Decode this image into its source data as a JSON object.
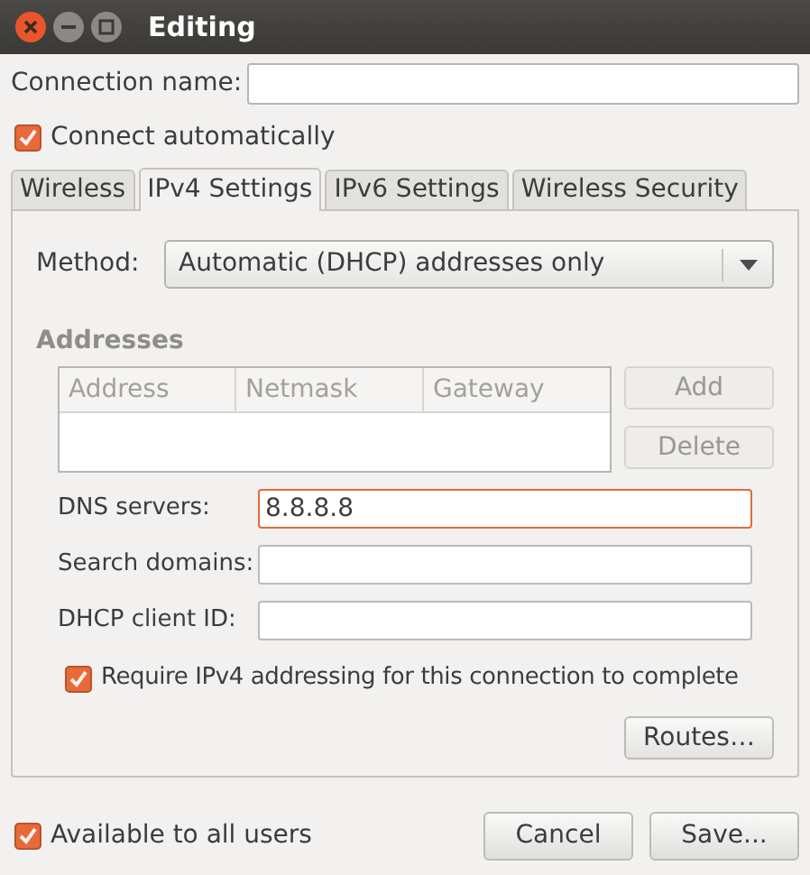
{
  "window": {
    "title": "Editing"
  },
  "connection_name": {
    "label": "Connection name:"
  },
  "connect_automatically": {
    "label": "Connect automatically",
    "checked": true
  },
  "tabs": [
    {
      "label": "Wireless",
      "selected": false
    },
    {
      "label": "IPv4 Settings",
      "selected": true
    },
    {
      "label": "IPv6 Settings",
      "selected": false
    },
    {
      "label": "Wireless Security",
      "selected": false
    }
  ],
  "method": {
    "label": "Method:",
    "value": "Automatic (DHCP) addresses only"
  },
  "addresses": {
    "heading": "Addresses",
    "disabled": true,
    "columns": [
      "Address",
      "Netmask",
      "Gateway"
    ],
    "buttons": [
      {
        "label": "Add",
        "disabled": true
      },
      {
        "label": "Delete",
        "disabled": true
      }
    ]
  },
  "fields": [
    {
      "label": "DNS servers:",
      "value": "8.8.8.8",
      "focused": true
    },
    {
      "label": "Search domains:",
      "focused": false
    },
    {
      "label": "DHCP client ID:",
      "focused": false
    }
  ],
  "require_ipv4": {
    "label": "Require IPv4 addressing for this connection to complete",
    "checked": true
  },
  "routes_button": {
    "label": "Routes…"
  },
  "available_to_all": {
    "label": "Available to all users",
    "checked": true
  },
  "buttons": [
    {
      "label": "Cancel"
    },
    {
      "label": "Save..."
    }
  ]
}
